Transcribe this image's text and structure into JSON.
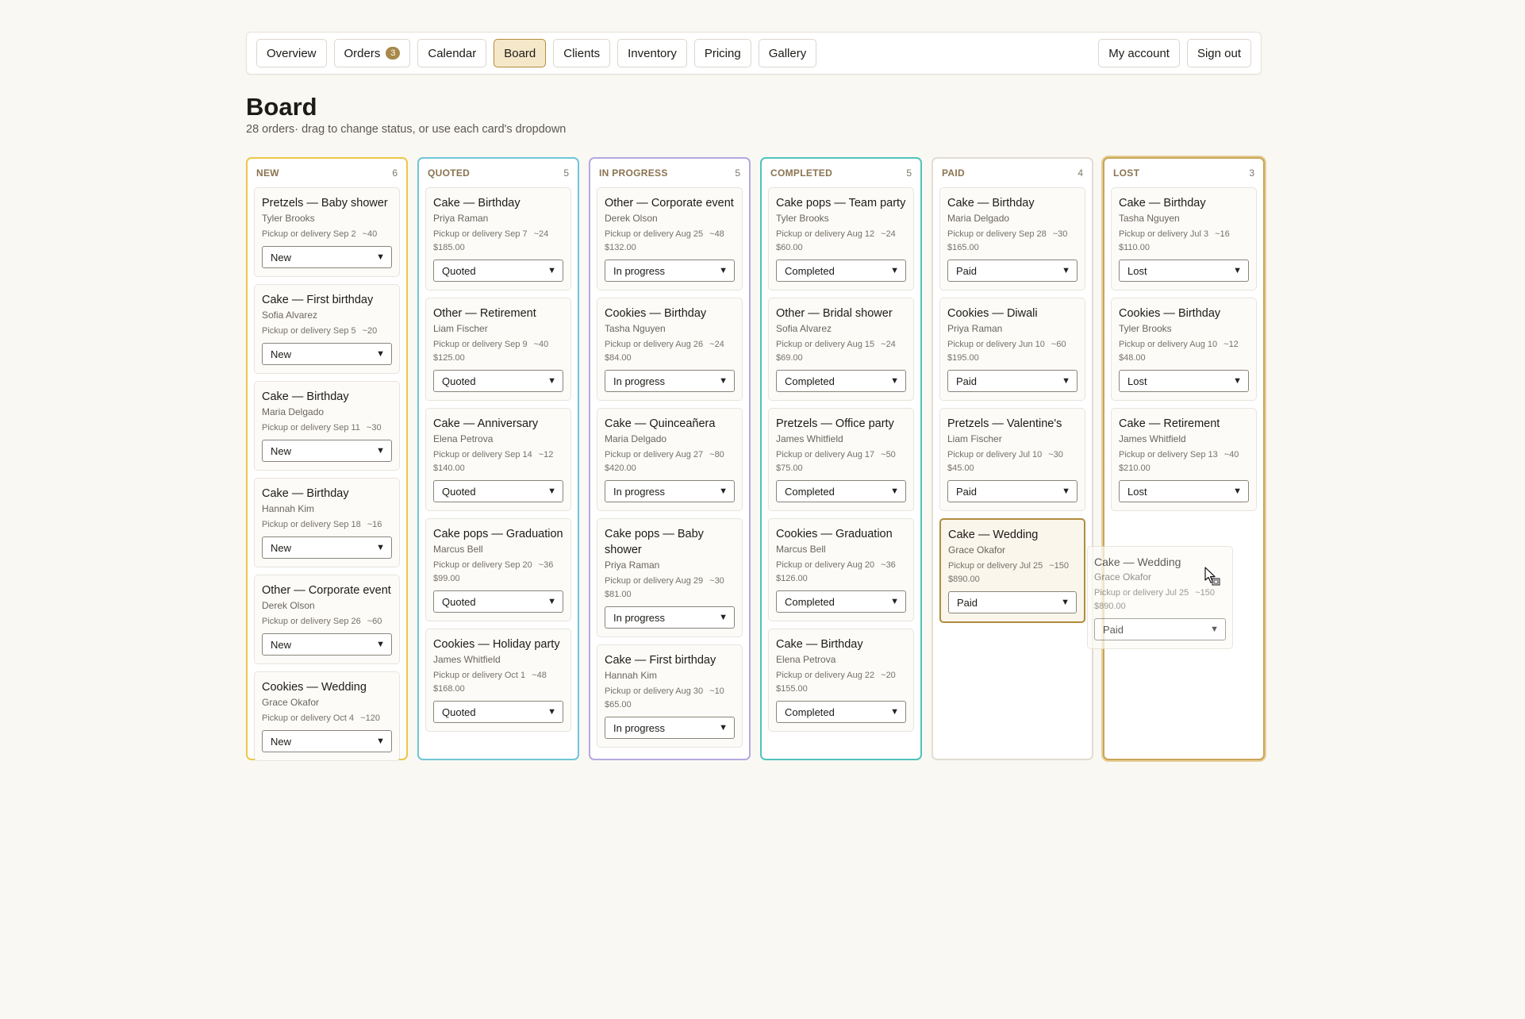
{
  "nav": {
    "items": [
      {
        "label": "Overview"
      },
      {
        "label": "Orders",
        "badge": "3"
      },
      {
        "label": "Calendar"
      },
      {
        "label": "Board",
        "active": true
      },
      {
        "label": "Clients"
      },
      {
        "label": "Inventory"
      },
      {
        "label": "Pricing"
      },
      {
        "label": "Gallery"
      }
    ],
    "account_label": "My account",
    "signout_label": "Sign out"
  },
  "page": {
    "title": "Board",
    "subtitle": "28 orders· drag to change status, or use each card's dropdown"
  },
  "columns": [
    {
      "name": "NEW",
      "count": "6",
      "cards": [
        {
          "title": "Pretzels — Baby shower",
          "client": "Tyler Brooks",
          "pickup": "Pickup or delivery Sep 2",
          "qty": "~40",
          "status": "New"
        },
        {
          "title": "Cake — First birthday",
          "client": "Sofia Alvarez",
          "pickup": "Pickup or delivery Sep 5",
          "qty": "~20",
          "status": "New"
        },
        {
          "title": "Cake — Birthday",
          "client": "Maria Delgado",
          "pickup": "Pickup or delivery Sep 11",
          "qty": "~30",
          "status": "New"
        },
        {
          "title": "Cake — Birthday",
          "client": "Hannah Kim",
          "pickup": "Pickup or delivery Sep 18",
          "qty": "~16",
          "status": "New"
        },
        {
          "title": "Other — Corporate event",
          "client": "Derek Olson",
          "pickup": "Pickup or delivery Sep 26",
          "qty": "~60",
          "status": "New"
        },
        {
          "title": "Cookies — Wedding",
          "client": "Grace Okafor",
          "pickup": "Pickup or delivery Oct 4",
          "qty": "~120",
          "status": "New"
        }
      ]
    },
    {
      "name": "QUOTED",
      "count": "5",
      "cards": [
        {
          "title": "Cake — Birthday",
          "client": "Priya Raman",
          "pickup": "Pickup or delivery Sep 7",
          "qty": "~24",
          "price": "$185.00",
          "status": "Quoted"
        },
        {
          "title": "Other — Retirement",
          "client": "Liam Fischer",
          "pickup": "Pickup or delivery Sep 9",
          "qty": "~40",
          "price": "$125.00",
          "status": "Quoted"
        },
        {
          "title": "Cake — Anniversary",
          "client": "Elena Petrova",
          "pickup": "Pickup or delivery Sep 14",
          "qty": "~12",
          "price": "$140.00",
          "status": "Quoted"
        },
        {
          "title": "Cake pops — Graduation",
          "client": "Marcus Bell",
          "pickup": "Pickup or delivery Sep 20",
          "qty": "~36",
          "price": "$99.00",
          "status": "Quoted"
        },
        {
          "title": "Cookies — Holiday party",
          "client": "James Whitfield",
          "pickup": "Pickup or delivery Oct 1",
          "qty": "~48",
          "price": "$168.00",
          "status": "Quoted"
        }
      ]
    },
    {
      "name": "IN PROGRESS",
      "count": "5",
      "cards": [
        {
          "title": "Other — Corporate event",
          "client": "Derek Olson",
          "pickup": "Pickup or delivery Aug 25",
          "qty": "~48",
          "price": "$132.00",
          "status": "In progress"
        },
        {
          "title": "Cookies — Birthday",
          "client": "Tasha Nguyen",
          "pickup": "Pickup or delivery Aug 26",
          "qty": "~24",
          "price": "$84.00",
          "status": "In progress"
        },
        {
          "title": "Cake — Quinceañera",
          "client": "Maria Delgado",
          "pickup": "Pickup or delivery Aug 27",
          "qty": "~80",
          "price": "$420.00",
          "status": "In progress"
        },
        {
          "title": "Cake pops — Baby shower",
          "client": "Priya Raman",
          "pickup": "Pickup or delivery Aug 29",
          "qty": "~30",
          "price": "$81.00",
          "status": "In progress"
        },
        {
          "title": "Cake — First birthday",
          "client": "Hannah Kim",
          "pickup": "Pickup or delivery Aug 30",
          "qty": "~10",
          "price": "$65.00",
          "status": "In progress"
        }
      ]
    },
    {
      "name": "COMPLETED",
      "count": "5",
      "cards": [
        {
          "title": "Cake pops — Team party",
          "client": "Tyler Brooks",
          "pickup": "Pickup or delivery Aug 12",
          "qty": "~24",
          "price": "$60.00",
          "status": "Completed"
        },
        {
          "title": "Other — Bridal shower",
          "client": "Sofia Alvarez",
          "pickup": "Pickup or delivery Aug 15",
          "qty": "~24",
          "price": "$69.00",
          "status": "Completed"
        },
        {
          "title": "Pretzels — Office party",
          "client": "James Whitfield",
          "pickup": "Pickup or delivery Aug 17",
          "qty": "~50",
          "price": "$75.00",
          "status": "Completed"
        },
        {
          "title": "Cookies — Graduation",
          "client": "Marcus Bell",
          "pickup": "Pickup or delivery Aug 20",
          "qty": "~36",
          "price": "$126.00",
          "status": "Completed"
        },
        {
          "title": "Cake — Birthday",
          "client": "Elena Petrova",
          "pickup": "Pickup or delivery Aug 22",
          "qty": "~20",
          "price": "$155.00",
          "status": "Completed"
        }
      ]
    },
    {
      "name": "PAID",
      "count": "4",
      "cards": [
        {
          "title": "Cake — Birthday",
          "client": "Maria Delgado",
          "pickup": "Pickup or delivery Sep 28",
          "qty": "~30",
          "price": "$165.00",
          "status": "Paid"
        },
        {
          "title": "Cookies — Diwali",
          "client": "Priya Raman",
          "pickup": "Pickup or delivery Jun 10",
          "qty": "~60",
          "price": "$195.00",
          "status": "Paid"
        },
        {
          "title": "Pretzels — Valentine's",
          "client": "Liam Fischer",
          "pickup": "Pickup or delivery Jul 10",
          "qty": "~30",
          "price": "$45.00",
          "status": "Paid"
        },
        {
          "title": "Cake — Wedding",
          "client": "Grace Okafor",
          "pickup": "Pickup or delivery Jul 25",
          "qty": "~150",
          "price": "$890.00",
          "status": "Paid",
          "highlight": true
        }
      ]
    },
    {
      "name": "LOST",
      "count": "3",
      "cards": [
        {
          "title": "Cake — Birthday",
          "client": "Tasha Nguyen",
          "pickup": "Pickup or delivery Jul 3",
          "qty": "~16",
          "price": "$110.00",
          "status": "Lost"
        },
        {
          "title": "Cookies — Birthday",
          "client": "Tyler Brooks",
          "pickup": "Pickup or delivery Aug 10",
          "qty": "~12",
          "price": "$48.00",
          "status": "Lost"
        },
        {
          "title": "Cake — Retirement",
          "client": "James Whitfield",
          "pickup": "Pickup or delivery Sep 13",
          "qty": "~40",
          "price": "$210.00",
          "status": "Lost"
        }
      ]
    }
  ],
  "drag_ghost": {
    "title": "Cake — Wedding",
    "client": "Grace Okafor",
    "pickup": "Pickup or delivery Jul 25",
    "qty": "~150",
    "price": "$890.00",
    "status": "Paid"
  },
  "cursor_icon": "drag-copy-cursor-icon"
}
